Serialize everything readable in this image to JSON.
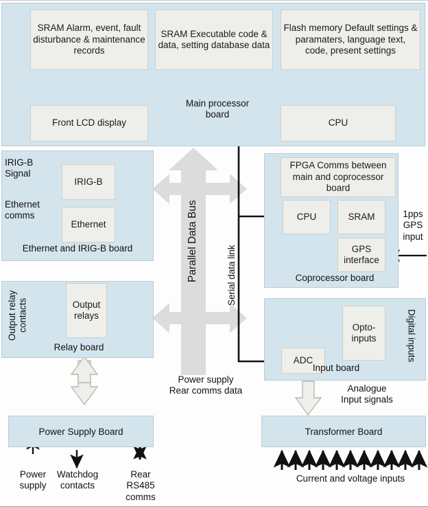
{
  "diagram": {
    "title": "Numerical relay hardware block diagram",
    "colors": {
      "board_fill": "#d3e4ed",
      "unit_fill": "#eeeeea",
      "bus_fill": "#dcdcdc",
      "hollow_arrow_fill": "#eeeeea",
      "line": "#111111"
    }
  },
  "main_processor_board": {
    "label": "Main processor\nboard",
    "units": [
      {
        "name": "sram-records",
        "text": "SRAM\nAlarm, event, fault\ndisturbance &\nmaintenance records"
      },
      {
        "name": "sram-code",
        "text": "SRAM\nExecutable code &\ndata, setting database\ndata"
      },
      {
        "name": "flash-memory",
        "text": "Flash memory\nDefault settings &\nparamaters, language text,\ncode, present settings"
      },
      {
        "name": "front-lcd-display",
        "text": "Front LCD display"
      },
      {
        "name": "cpu",
        "text": "CPU"
      }
    ]
  },
  "ethernet_irigb_board": {
    "label": "Ethernet and IRIG-B board",
    "units": [
      {
        "name": "irig-b",
        "text": "IRIG-B"
      },
      {
        "name": "ethernet",
        "text": "Ethernet"
      }
    ],
    "inputs": [
      {
        "name": "irigb-signal",
        "text": "IRIG-B\nSignal"
      },
      {
        "name": "ethernet-comms",
        "text": "Ethernet\ncomms"
      }
    ]
  },
  "relay_board": {
    "label": "Relay board",
    "units": [
      {
        "name": "output-relays",
        "text": "Output\nrelays"
      }
    ],
    "side_label": "Output relay\ncontacts",
    "contact_count": 8
  },
  "coprocessor_board": {
    "label": "Coprocessor board",
    "units": [
      {
        "name": "fpga",
        "text": "FPGA\nComms between main\nand coprocessor board"
      },
      {
        "name": "cpu",
        "text": "CPU"
      },
      {
        "name": "sram",
        "text": "SRAM"
      },
      {
        "name": "gps-interface",
        "text": "GPS\ninterface"
      }
    ],
    "inputs": [
      {
        "name": "gps-input",
        "text": "1pps\nGPS\ninput"
      }
    ]
  },
  "input_board": {
    "label": "Input board",
    "units": [
      {
        "name": "adc",
        "text": "ADC"
      },
      {
        "name": "opto-inputs",
        "text": "Opto-\ninputs"
      }
    ],
    "side_label": "Digital inputs",
    "digital_input_count": 8,
    "analogue_label": "Analogue\nInput signals"
  },
  "power_supply_board": {
    "label": "Power Supply Board",
    "connections": [
      {
        "name": "power-supply",
        "text": "Power\nsupply",
        "direction": "up"
      },
      {
        "name": "watchdog-contacts",
        "text": "Watchdog\ncontacts",
        "direction": "down"
      },
      {
        "name": "rear-rs485-comms",
        "text": "Rear\nRS485\ncomms",
        "direction": "both"
      }
    ]
  },
  "transformer_board": {
    "label": "Transformer Board",
    "input_label": "Current and voltage inputs",
    "input_count": 11
  },
  "buses": {
    "parallel_data_bus": "Parallel Data Bus",
    "serial_data_link": "Serial data link",
    "power_rear_comms": "Power supply\nRear comms data"
  }
}
